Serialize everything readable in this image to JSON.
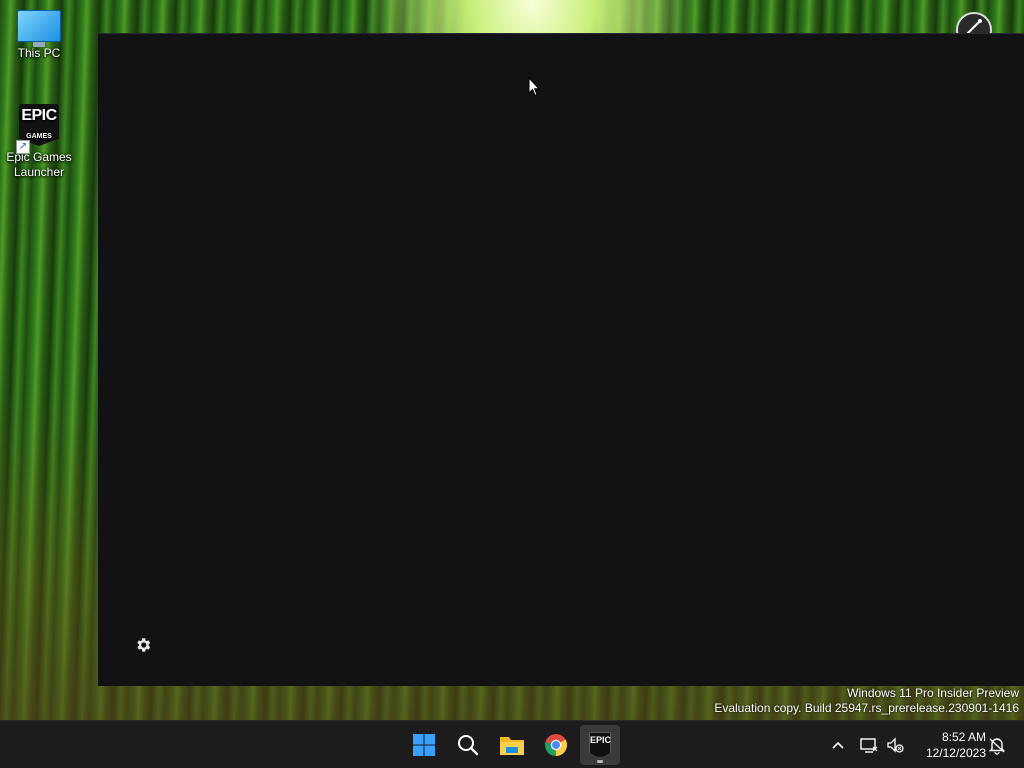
{
  "desktop": {
    "icons": [
      {
        "label": "This PC",
        "icon": "monitor-icon"
      },
      {
        "label": "Epic Games Launcher",
        "icon": "epic-games-icon",
        "logo_text_top": "EPIC",
        "logo_text_bottom": "GAMES"
      }
    ]
  },
  "watermark": {
    "line1": "Windows 11 Pro Insider Preview",
    "line2": "Evaluation copy. Build 25947.rs_prerelease.230901-1416"
  },
  "app_window": {
    "background": "#121214",
    "settings_icon": "gear-icon"
  },
  "taskbar": {
    "items": [
      {
        "name": "start",
        "icon": "windows-logo-icon"
      },
      {
        "name": "search",
        "icon": "search-icon"
      },
      {
        "name": "file-explorer",
        "icon": "folder-icon"
      },
      {
        "name": "chrome",
        "icon": "chrome-icon"
      },
      {
        "name": "epic-games-launcher",
        "icon": "epic-games-icon",
        "active": true,
        "logo_text": "EPIC"
      }
    ],
    "tray": {
      "time": "8:52 AM",
      "date": "12/12/2023"
    },
    "colors": {
      "background": "#1c1c1c",
      "start_blue": "#3aa0ff"
    }
  }
}
